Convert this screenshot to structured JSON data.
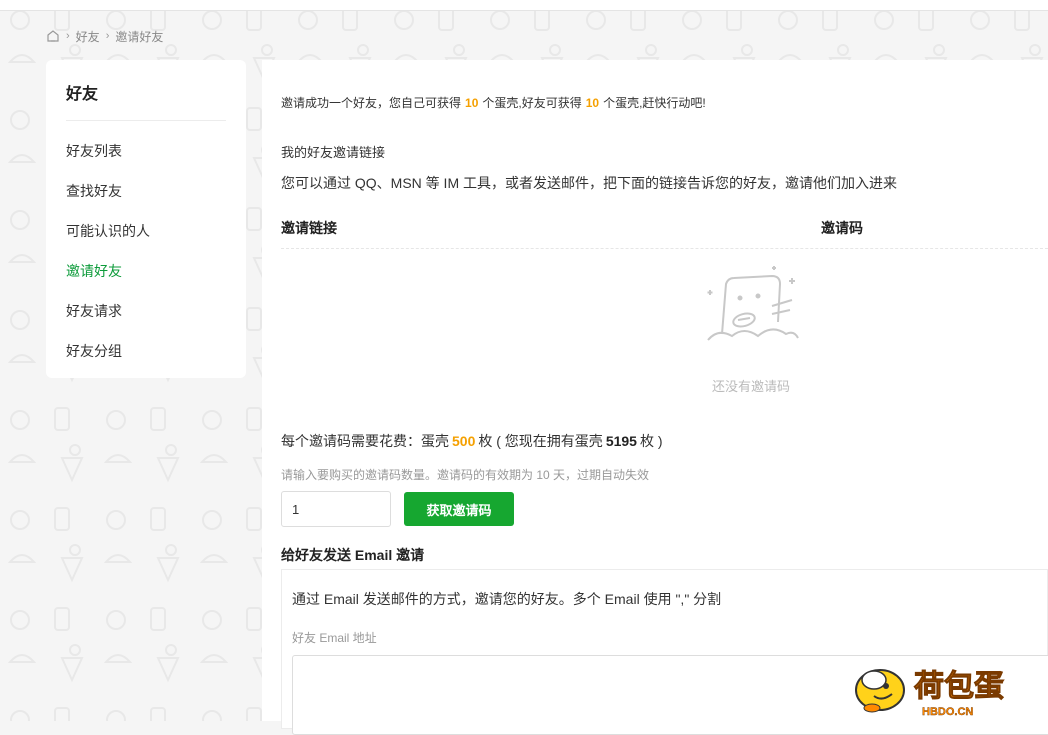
{
  "breadcrumb": {
    "home_icon": "home-icon",
    "items": [
      "好友",
      "邀请好友"
    ]
  },
  "sidebar": {
    "title": "好友",
    "items": [
      {
        "label": "好友列表",
        "active": false
      },
      {
        "label": "查找好友",
        "active": false
      },
      {
        "label": "可能认识的人",
        "active": false
      },
      {
        "label": "邀请好友",
        "active": true
      },
      {
        "label": "好友请求",
        "active": false
      },
      {
        "label": "好友分组",
        "active": false
      }
    ]
  },
  "main": {
    "notice": {
      "prefix": "邀请成功一个好友，您自己可获得",
      "self_reward": "10",
      "middle": "个蛋壳,好友可获得",
      "friend_reward": "10",
      "suffix": "个蛋壳,赶快行动吧!"
    },
    "invite_link_label": "我的好友邀请链接",
    "invite_desc": "您可以通过 QQ、MSN 等 IM 工具，或者发送邮件，把下面的链接告诉您的好友，邀请他们加入进来",
    "table": {
      "col_link": "邀请链接",
      "col_code": "邀请码",
      "empty_text": "还没有邀请码"
    },
    "cost": {
      "prefix": "每个邀请码需要花费：蛋壳",
      "price": "500",
      "middle": "枚 ( 您现在拥有蛋壳",
      "balance": "5195",
      "suffix": "枚 )"
    },
    "hint": "请输入要购买的邀请码数量。邀请码的有效期为 10 天，过期自动失效",
    "quantity_value": "1",
    "get_button": "获取邀请码",
    "email": {
      "title": "给好友发送 Email 邀请",
      "desc": "通过 Email 发送邮件的方式，邀请您的好友。多个 Email 使用 \",\" 分割",
      "field_label": "好友 Email 地址"
    }
  },
  "watermark": {
    "text": "荷包蛋",
    "domain": "HBDO.CN"
  },
  "colors": {
    "accent_green": "#16a730",
    "active_green": "#0c9b3a",
    "highlight_orange": "#f5a000"
  }
}
